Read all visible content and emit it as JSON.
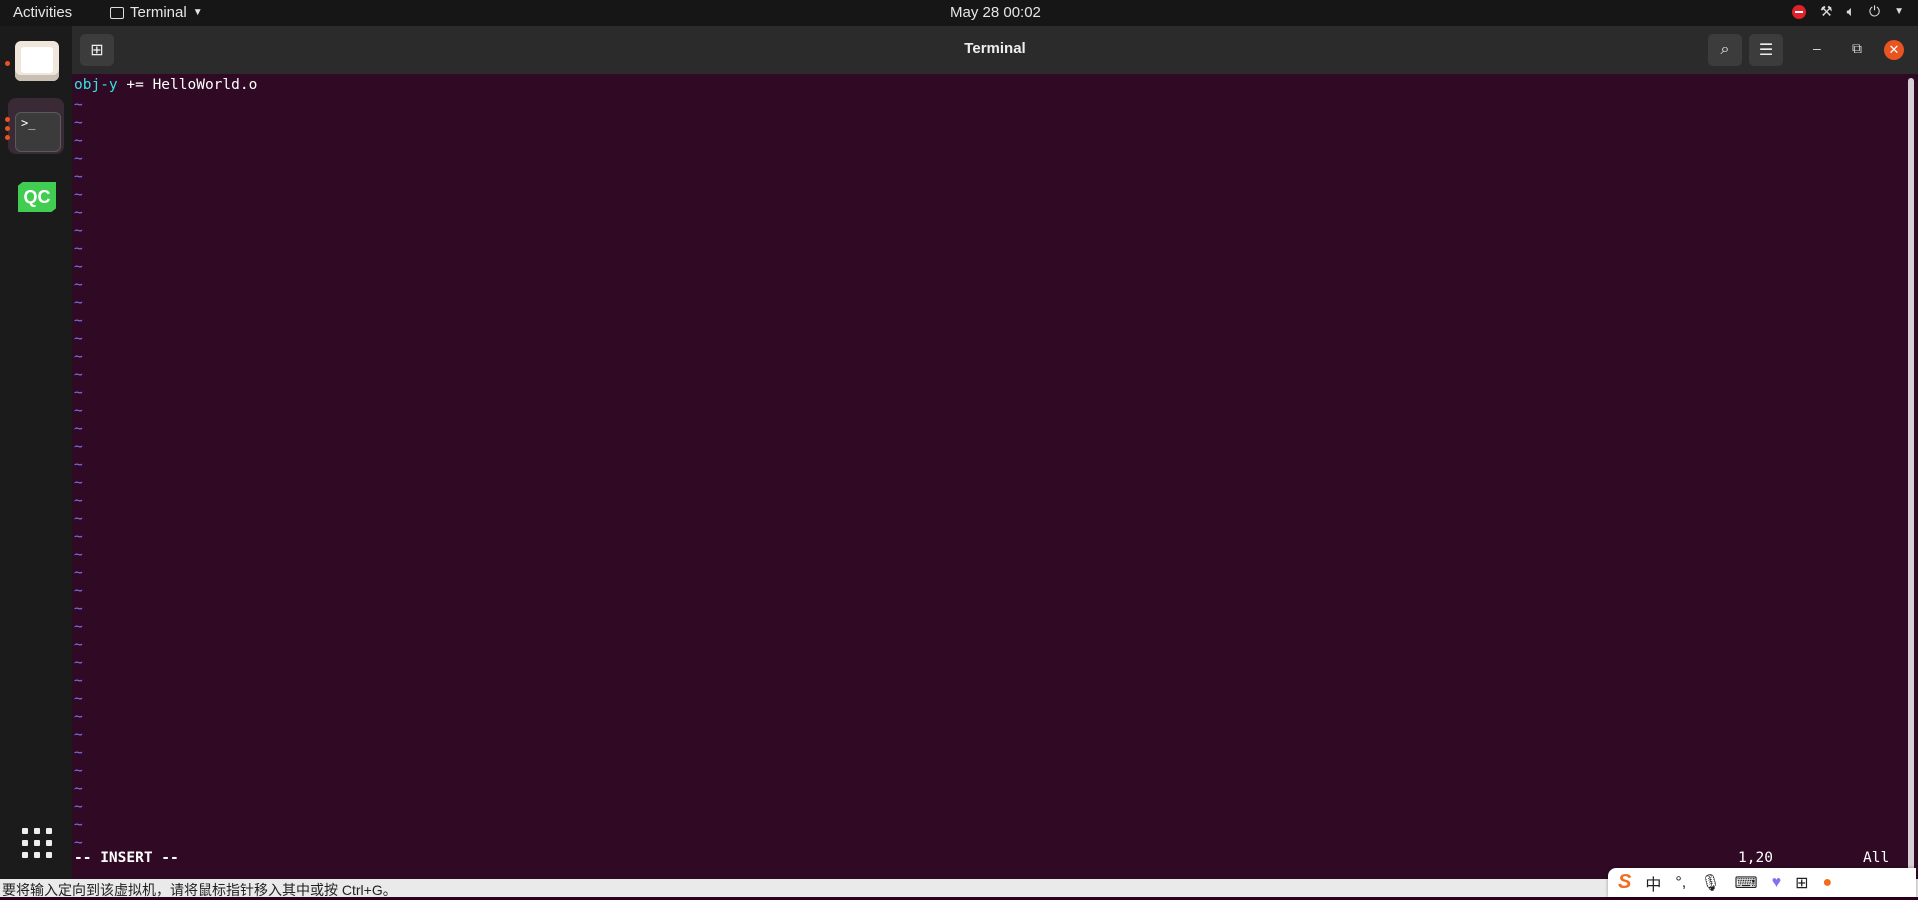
{
  "topbar": {
    "activities": "Activities",
    "app_name": "Terminal",
    "clock": "May 28  00:02"
  },
  "window": {
    "title": "Terminal"
  },
  "editor": {
    "line1_keyword": "obj-y",
    "line1_rest": " += HelloWorld.o",
    "tilde": "~",
    "mode": "-- INSERT --",
    "position": "1,20",
    "scroll": "All"
  },
  "vm_bar": {
    "message": "要将输入定向到该虚拟机，请将鼠标指针移入其中或按 Ctrl+G。"
  },
  "ime": {
    "chinese_mode": "中",
    "punct": "°,"
  },
  "dock": {
    "qc_label": "QC",
    "terminal_glyph": ">_"
  }
}
